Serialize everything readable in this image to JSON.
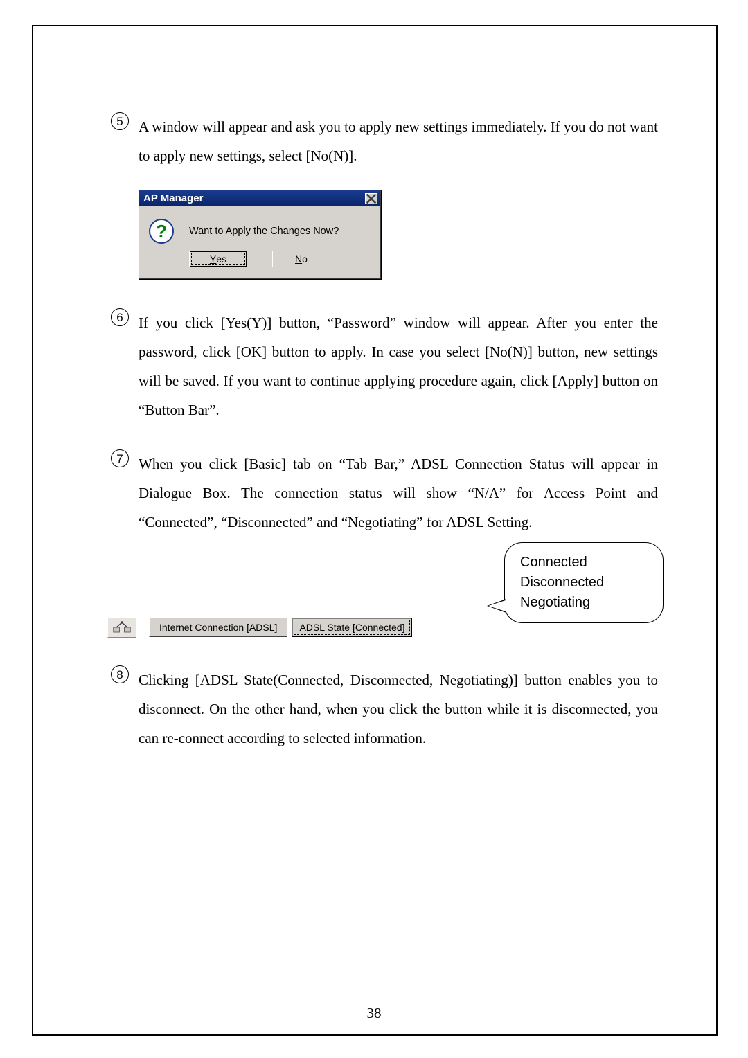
{
  "page_number": "38",
  "items": {
    "5": {
      "num": "5",
      "text": "A window will appear and ask you to apply new settings immediately. If you do not want to apply new settings, select [No(N)]."
    },
    "6": {
      "num": "6",
      "text": "If you click [Yes(Y)] button, “Password” window will appear. After you enter the password, click [OK] button to apply. In case you select [No(N)] button, new settings will be saved. If you want to continue applying procedure again, click [Apply] button on “Button Bar”."
    },
    "7": {
      "num": "7",
      "text": "When you click [Basic] tab on “Tab Bar,” ADSL Connection Status will appear in Dialogue Box. The connection status will show “N/A” for Access Point and “Connected”, “Disconnected” and “Negotiating” for ADSL Setting."
    },
    "8": {
      "num": "8",
      "text": "Clicking [ADSL State(Connected, Disconnected, Negotiating)] button enables you to disconnect. On the other hand, when you click the button while it is disconnected, you can re-connect according to selected information."
    }
  },
  "dialog": {
    "title": "AP Manager",
    "message": "Want to Apply the Changes Now?",
    "yes_u": "Y",
    "yes_rest": "es",
    "no_u": "N",
    "no_rest": "o"
  },
  "status": {
    "label": "Internet Connection [ADSL]",
    "state": "ADSL State [Connected]"
  },
  "callout": {
    "line1": "Connected",
    "line2": "Disconnected",
    "line3": "Negotiating"
  }
}
